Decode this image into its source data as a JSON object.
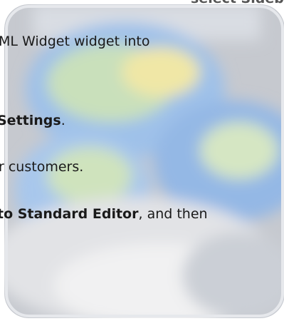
{
  "instructions": {
    "line_top_bold": "select Sidebar.",
    "line1": "ML Widget widget into",
    "line2_bold": "Settings",
    "line2_suffix": ".",
    "line3": "r customers.",
    "line4_bold": "to Standard Editor",
    "line4_suffix": ", and then"
  },
  "image": {
    "icon_name": "blurred-app-icon",
    "colors": {
      "frame": "#c9ccd2",
      "blue": "#8fb6e6",
      "green": "#c9dfb8",
      "yellow": "#efe7a3",
      "white": "#f3f3f3"
    }
  }
}
